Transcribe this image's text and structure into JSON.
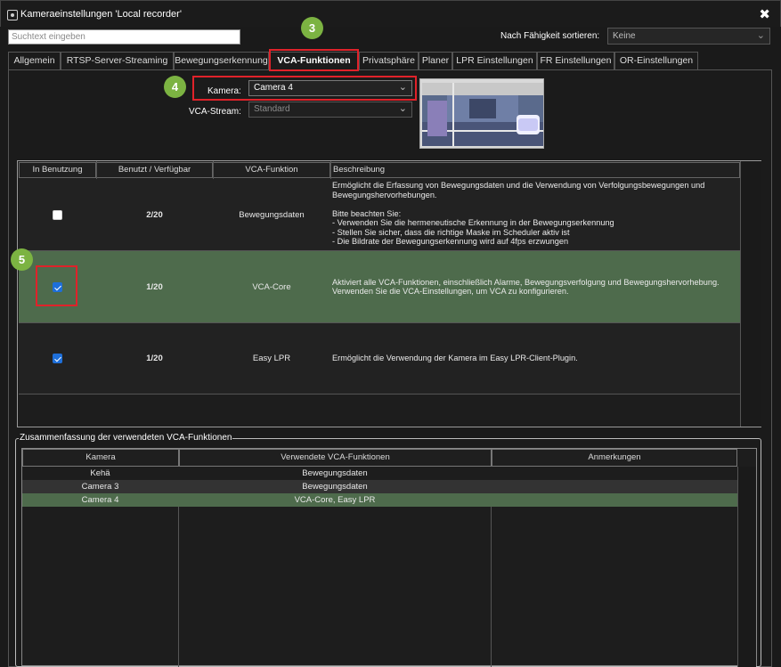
{
  "window": {
    "title": "Kameraeinstellungen 'Local recorder'",
    "close_glyph": "✖"
  },
  "search": {
    "placeholder": "Suchtext eingeben"
  },
  "sort": {
    "label": "Nach Fähigkeit sortieren:",
    "value": "Keine"
  },
  "tabs": [
    {
      "label": "Allgemein"
    },
    {
      "label": "RTSP-Server-Streaming"
    },
    {
      "label": "Bewegungserkennung"
    },
    {
      "label": "VCA-Funktionen",
      "active": true
    },
    {
      "label": "Privatsphäre"
    },
    {
      "label": "Planer"
    },
    {
      "label": "LPR Einstellungen"
    },
    {
      "label": "FR Einstellungen"
    },
    {
      "label": "OR-Einstellungen"
    }
  ],
  "callouts": {
    "tabs": "3",
    "camera": "4",
    "checkbox": "5"
  },
  "camera": {
    "label": "Kamera:",
    "value": "Camera 4"
  },
  "stream": {
    "label": "VCA-Stream:",
    "value": "Standard"
  },
  "vca_table": {
    "headers": [
      "In Benutzung",
      "Benutzt / Verfügbar",
      "VCA-Funktion",
      "Beschreibung"
    ],
    "rows": [
      {
        "checked": false,
        "usage": "2/20",
        "function": "Bewegungsdaten",
        "description": "Ermöglicht die Erfassung von Bewegungsdaten und die Verwendung von Verfolgungsbewegungen und Bewegungshervorhebungen.\n\nBitte beachten Sie:\n- Verwenden Sie die hermeneutische Erkennung in der Bewegungserkennung\n- Stellen Sie sicher, dass die richtige Maske im Scheduler aktiv ist\n- Die Bildrate der Bewegungserkennung wird auf 4fps erzwungen"
      },
      {
        "checked": true,
        "usage": "1/20",
        "function": "VCA-Core",
        "description": "Aktiviert alle VCA-Funktionen, einschließlich Alarme, Bewegungsverfolgung und Bewegungshervorhebung.\nVerwenden Sie die VCA-Einstellungen, um VCA zu konfigurieren."
      },
      {
        "checked": true,
        "usage": "1/20",
        "function": "Easy LPR",
        "description": "Ermöglicht die Verwendung der Kamera im Easy LPR-Client-Plugin."
      }
    ]
  },
  "summary": {
    "legend": "Zusammenfassung der verwendeten VCA-Funktionen",
    "headers": [
      "Kamera",
      "Verwendete VCA-Funktionen",
      "Anmerkungen"
    ],
    "rows": [
      {
        "camera": "Kehä",
        "functions": "Bewegungsdaten",
        "notes": ""
      },
      {
        "camera": "Camera 3",
        "functions": "Bewegungsdaten",
        "notes": ""
      },
      {
        "camera": "Camera 4",
        "functions": "VCA-Core, Easy LPR",
        "notes": ""
      }
    ]
  },
  "colors": {
    "highlight_red": "#e0222a",
    "callout_green": "#7cb342",
    "selected_row": "#4e6b4c",
    "checkbox_blue": "#1e6fd9"
  }
}
